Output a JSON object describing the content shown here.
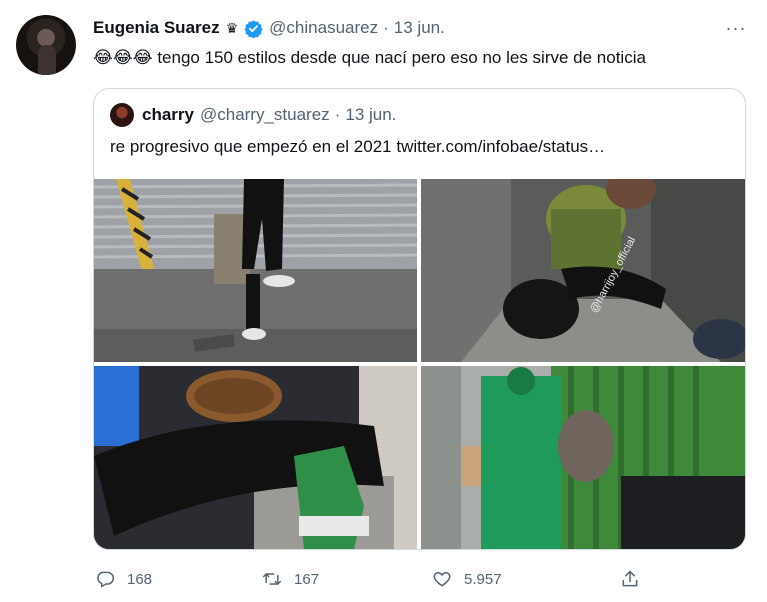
{
  "tweet": {
    "author_name": "Eugenia Suarez",
    "crown_icon": "♛",
    "handle": "@chinasuarez",
    "separator": "·",
    "date": "13 jun.",
    "more": "···",
    "emoji": "😂😂😂",
    "text": "tengo 150 estilos desde que nací pero eso no les sirve de noticia"
  },
  "quote": {
    "author_name": "charry",
    "handle": "@charry_stuarez",
    "separator": "·",
    "date": "13 jun.",
    "text": "re progresivo que empezó en el 2021  twitter.com/infobae/status…",
    "watermark": "@harrijoy_official"
  },
  "actions": {
    "reply_count": "168",
    "retweet_count": "167",
    "like_count": "5.957"
  },
  "colors": {
    "verified": "#1d9bf0",
    "text_secondary": "#536471",
    "border": "#cfd9de"
  }
}
